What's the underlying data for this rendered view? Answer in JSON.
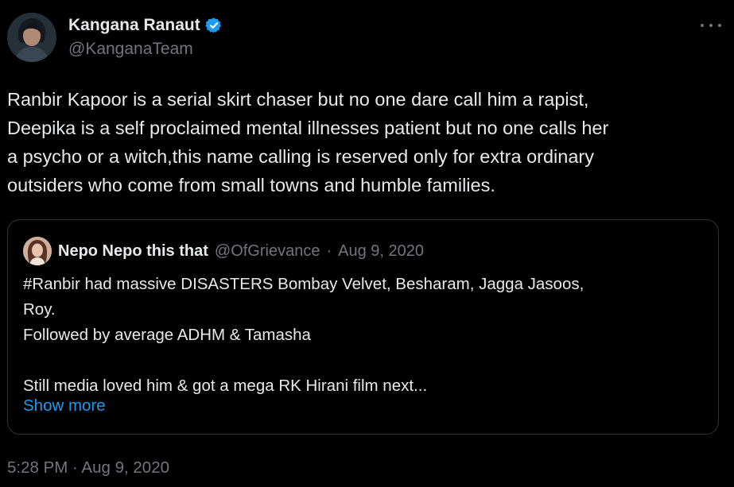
{
  "author": {
    "display_name": "Kangana Ranaut",
    "handle": "@KanganaTeam",
    "verified": true
  },
  "tweet": {
    "lines": [
      "Ranbir Kapoor is a serial skirt chaser but no one dare call him a rapist,",
      "Deepika is a self proclaimed mental illnesses patient but no one calls her",
      "a psycho or a witch,this name calling is reserved only for extra ordinary",
      "outsiders who come from small towns and humble families."
    ],
    "timestamp": "5:28 PM · Aug 9, 2020"
  },
  "quote": {
    "display_name": "Nepo Nepo this that",
    "handle": "@OfGrievance",
    "separator": "·",
    "date": "Aug 9, 2020",
    "lines": [
      "#Ranbir had massive DISASTERS Bombay Velvet, Besharam, Jagga Jasoos,",
      "Roy.",
      "Followed by average ADHM & Tamasha",
      "",
      "Still media loved him & got a mega RK Hirani film next..."
    ],
    "show_more": "Show more"
  },
  "icons": {
    "verified": "verified-badge-icon",
    "more": "more-icon"
  },
  "colors": {
    "background": "#000000",
    "text_primary": "#e7e9ea",
    "text_secondary": "#71767b",
    "accent": "#1d9bf0",
    "border": "#2f3336"
  }
}
